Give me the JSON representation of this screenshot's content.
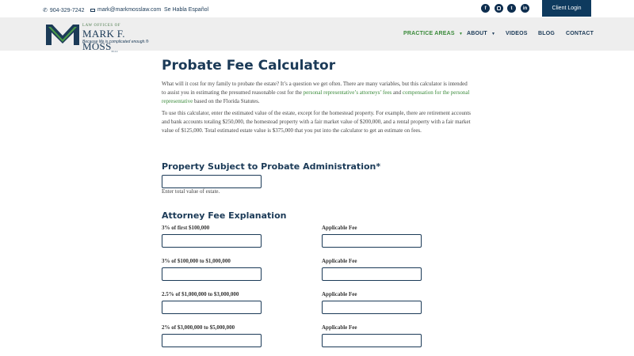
{
  "topbar": {
    "phone": "904-329-7242",
    "email": "mark@markmosslaw.com",
    "espanol": "Se Habla Español",
    "social_icons": [
      "facebook-icon",
      "instagram-icon",
      "twitter-icon",
      "linkedin-icon"
    ],
    "client_login": "Client Login"
  },
  "logo": {
    "line1": "LAW OFFICES OF",
    "line2": "MARK F. MOSS",
    "suffix": "PLLC",
    "tagline": "Because life is complicated enough.®"
  },
  "nav": {
    "practice_areas": "PRACTICE AREAS",
    "about": "ABOUT",
    "videos": "VIDEOS",
    "blog": "BLOG",
    "contact": "CONTACT"
  },
  "main": {
    "title": "Probate Fee Calculator",
    "intro_p1_a": "What will it cost for my family to probate the estate? It’s a question we get often. There are many variables, but this calculator is intended to assist you in estimating the presumed reasonable cost for the ",
    "intro_link1": "personal representative’s attorneys’ fees",
    "intro_p1_b": " and ",
    "intro_link2": "compensation for the personal representative",
    "intro_p1_c": " based on the Florida Statutes.",
    "intro_p2": "To use this calculator, enter the estimated value of the estate, except for the homestead property. For example, there are retirement accounts and bank accounts totaling $250,000, the homestead property with a fair market value of $200,000, and a rental property with a fair market value of $125,000. Total estimated estate value is $375,000 that you put into the calculator to get an estimate on fees.",
    "property_heading": "Property Subject to Probate Administration*",
    "property_helper": "Enter total value of estate.",
    "property_value": "",
    "fee_heading": "Attorney Fee Explanation",
    "fee_rows": [
      {
        "label": "3% of first $100,000",
        "fee_label": "Applicable Fee"
      },
      {
        "label": "3% of $100,000 to $1,000,000",
        "fee_label": "Applicable Fee"
      },
      {
        "label": "2.5% of $1,000,000 to $3,000,000",
        "fee_label": "Applicable Fee"
      },
      {
        "label": "2% of $3,000,000 to $5,000,000",
        "fee_label": "Applicable Fee"
      }
    ]
  },
  "colors": {
    "navy": "#1b3a57",
    "green": "#3a8a3a",
    "header_bg": "#eeeeee",
    "login_bg": "#0e3a5e"
  }
}
